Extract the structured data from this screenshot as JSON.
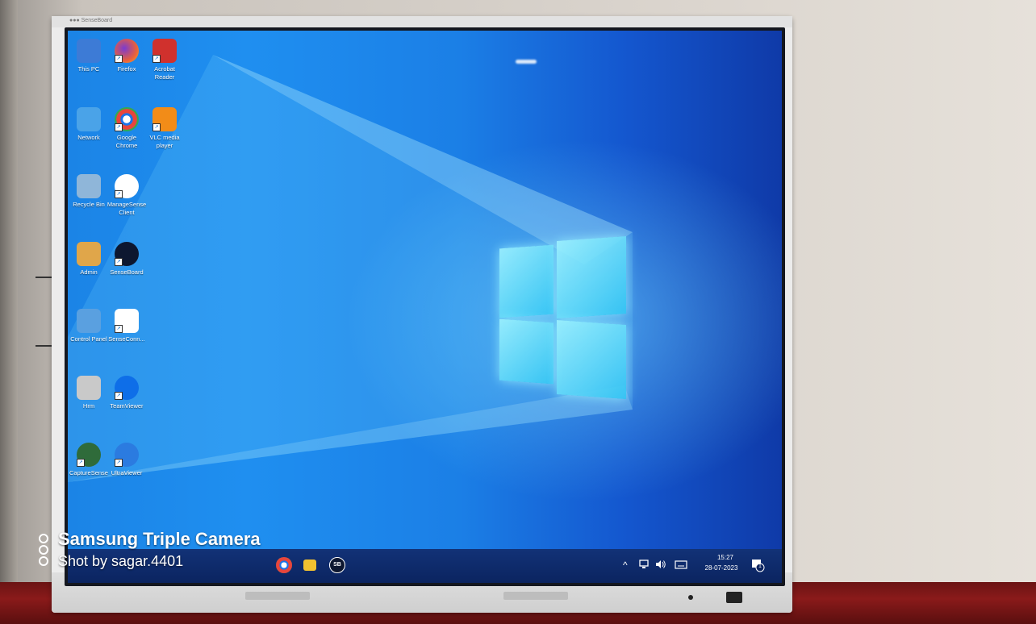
{
  "bezel": {
    "brand": "●●● SenseBoard"
  },
  "desktop": {
    "icons": [
      {
        "label": "This PC",
        "icon": "computer-icon",
        "color": "#3d7bd6"
      },
      {
        "label": "Firefox",
        "icon": "firefox-icon",
        "color": "#e8603c"
      },
      {
        "label": "Acrobat Reader",
        "icon": "acrobat-icon",
        "color": "#d0312d"
      },
      {
        "label": "Network",
        "icon": "network-icon",
        "color": "#4aa3e8"
      },
      {
        "label": "Google Chrome",
        "icon": "chrome-icon",
        "color": "#34a853"
      },
      {
        "label": "VLC media player",
        "icon": "vlc-icon",
        "color": "#f28c18"
      },
      {
        "label": "Recycle Bin",
        "icon": "recycle-bin-icon",
        "color": "#8fb6d9"
      },
      {
        "label": "ManageSense Client",
        "icon": "managesense-icon",
        "color": "#ffffff"
      },
      {
        "label": "Admin",
        "icon": "user-folder-icon",
        "color": "#e0a64a"
      },
      {
        "label": "SenseBoard",
        "icon": "senseboard-icon",
        "color": "#0d1730"
      },
      {
        "label": "Control Panel",
        "icon": "control-panel-icon",
        "color": "#5aa0e0"
      },
      {
        "label": "SenseConn...",
        "icon": "senseconn-icon",
        "color": "#ffffff"
      },
      {
        "label": "Hrm",
        "icon": "file-icon",
        "color": "#c9c9c9"
      },
      {
        "label": "TeamViewer",
        "icon": "teamviewer-icon",
        "color": "#0e6ee8"
      },
      {
        "label": "CaptureSense",
        "icon": "capturesense-icon",
        "color": "#2f6b3a"
      },
      {
        "label": "UltraViewer",
        "icon": "ultraviewer-icon",
        "color": "#2b7be0"
      }
    ]
  },
  "taskbar": {
    "apps": [
      {
        "icon": "chrome-icon",
        "color": "#e8453c"
      },
      {
        "icon": "file-explorer-icon",
        "color": "#f2c230"
      },
      {
        "icon": "senseboard-icon",
        "color": "#0d1730"
      }
    ],
    "tray": {
      "chevron": "^",
      "clock_time": "15:27",
      "clock_date": "28-07-2023",
      "notifications_count": "1"
    }
  },
  "watermark": {
    "title": "Samsung Triple Camera",
    "subtitle": "Shot by sagar.4401"
  }
}
